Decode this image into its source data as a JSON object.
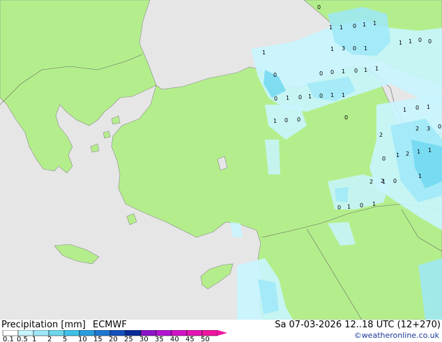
{
  "footer": {
    "title": "Precipitation [mm]",
    "model": "ECMWF",
    "datetime": "Sa 07-03-2026 12..18 UTC (12+270)",
    "credit": "©weatheronline.co.uk"
  },
  "legend": {
    "labels": [
      "0.1",
      "0.5",
      "1",
      "2",
      "5",
      "10",
      "15",
      "20",
      "25",
      "30",
      "35",
      "40",
      "45",
      "50"
    ],
    "colors": [
      "#ffffff",
      "#c8f5ff",
      "#9ee8f8",
      "#6dd7f0",
      "#3fc2ea",
      "#2a9fe0",
      "#1e78d2",
      "#1450bc",
      "#0a2a9a",
      "#8c14c8",
      "#b414d2",
      "#d214c8",
      "#e614b4",
      "#f014a0"
    ]
  },
  "map": {
    "land_color": "#b4ee8c",
    "sea_color": "#e6e6e6",
    "precip_light": "#c8f5ff",
    "precip_mid": "#9ee8f8",
    "precip_heavy": "#6dd7f0",
    "precip_values": [
      "0",
      "1",
      "1",
      "0",
      "1",
      "1",
      "1",
      "3",
      "0",
      "1",
      "1",
      "1",
      "0",
      "0",
      "1",
      "0",
      "0",
      "0",
      "1",
      "0",
      "1",
      "1",
      "0",
      "1",
      "0",
      "1",
      "0",
      "1",
      "1",
      "1",
      "0",
      "0",
      "0",
      "1",
      "0",
      "1",
      "0",
      "2",
      "3",
      "2",
      "1",
      "1",
      "1",
      "2",
      "0",
      "2",
      "2",
      "0",
      "0",
      "1",
      "0",
      "1",
      "1",
      "1"
    ]
  }
}
